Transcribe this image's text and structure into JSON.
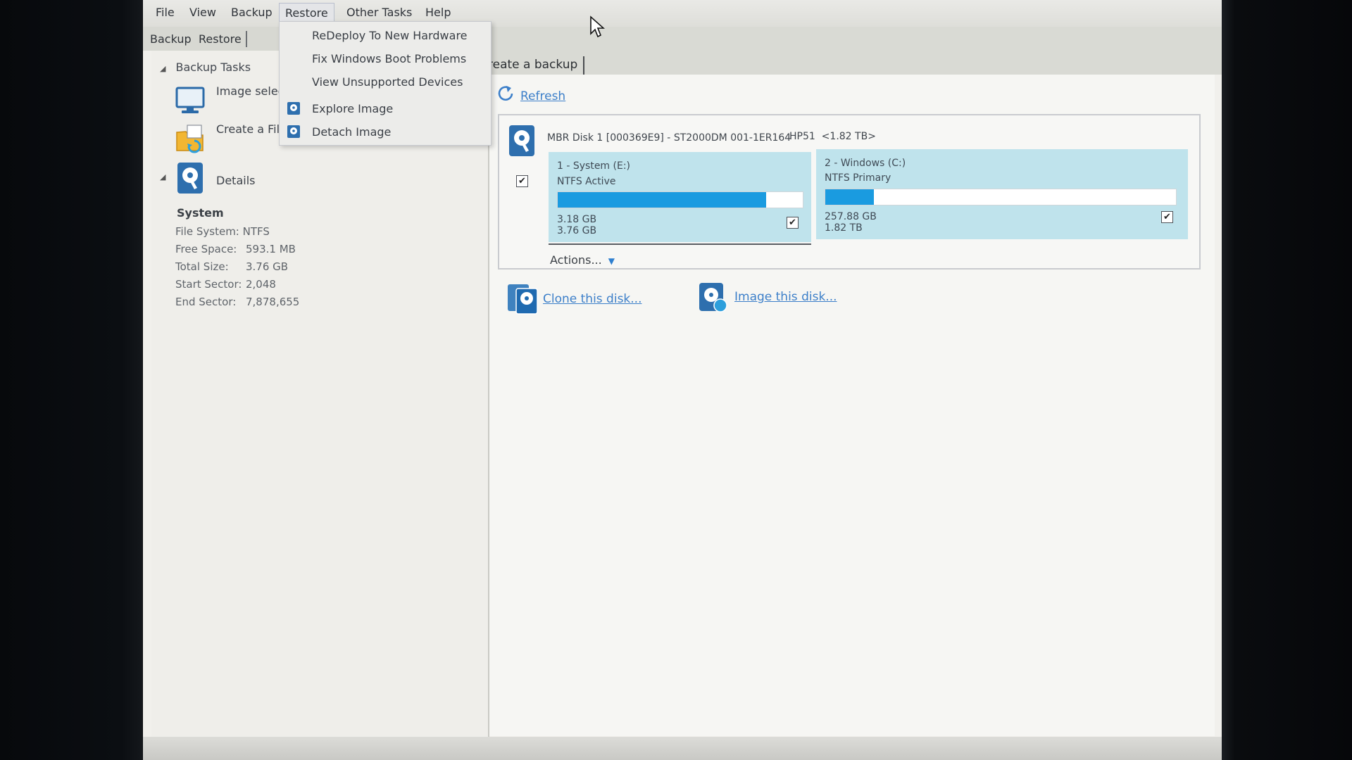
{
  "menubar": {
    "items": [
      "File",
      "View",
      "Backup",
      "Restore",
      "Other Tasks",
      "Help"
    ],
    "active": "Restore"
  },
  "tabs": [
    "Backup",
    "Restore"
  ],
  "restore_menu": {
    "items": [
      {
        "label": "ReDeploy To New Hardware",
        "icon": ""
      },
      {
        "label": "Fix Windows Boot Problems",
        "icon": ""
      },
      {
        "label": "View Unsupported Devices",
        "icon": ""
      },
      {
        "label": "Explore Image",
        "icon": "disk-image-icon"
      },
      {
        "label": "Detach Image",
        "icon": "disk-image-icon"
      }
    ]
  },
  "left": {
    "backup_tasks_title": "Backup Tasks",
    "tasks": [
      {
        "label": "Image select",
        "icon": "monitor-icon"
      },
      {
        "label": "Create a File",
        "icon": "folder-backup-icon"
      }
    ],
    "details_title": "Details",
    "details": {
      "heading": "System",
      "file_system": "File System: NTFS",
      "rows": [
        {
          "label": "Free Space:",
          "value": "593.1 MB"
        },
        {
          "label": "Total Size:",
          "value": "3.76 GB"
        },
        {
          "label": "Start Sector:",
          "value": "2,048"
        },
        {
          "label": "End Sector:",
          "value": "7,878,655"
        }
      ]
    }
  },
  "right": {
    "tab_label": "reate a backup",
    "refresh_label": "Refresh",
    "disk": {
      "title": "MBR Disk 1 [000369E9] - ST2000DM 001-1ER164",
      "info": "HP51  <1.82 TB>",
      "checked": true,
      "partitions": [
        {
          "name": "1 - System (E:)",
          "type": "NTFS Active",
          "used": "3.18 GB",
          "total": "3.76 GB",
          "fill": 0.85,
          "checked": true
        },
        {
          "name": "2 - Windows (C:)",
          "type": "NTFS Primary",
          "used": "257.88 GB",
          "total": "1.82 TB",
          "fill": 0.138,
          "checked": true
        }
      ],
      "actions_label": "Actions..."
    },
    "clone_label": "Clone this disk...",
    "image_label": "Image this disk..."
  },
  "colors": {
    "accent": "#1a9be0",
    "partition_bg": "#bfe3ec",
    "link": "#3c7fc9"
  }
}
